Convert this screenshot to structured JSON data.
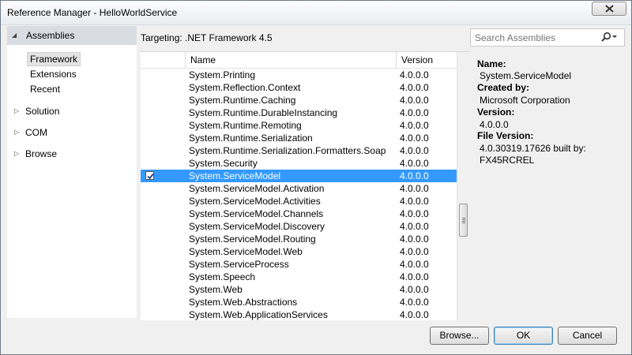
{
  "window": {
    "title": "Reference Manager - HelloWorldService",
    "close_glyph": "×"
  },
  "nav": {
    "expanded_group": "Assemblies",
    "sub_items": [
      "Framework",
      "Extensions",
      "Recent"
    ],
    "selected_sub_item": "Framework",
    "groups": [
      "Solution",
      "COM",
      "Browse"
    ]
  },
  "targeting": "Targeting: .NET Framework 4.5",
  "search": {
    "placeholder": "Search Assemblies",
    "icon": "search-icon"
  },
  "list": {
    "columns": {
      "name": "Name",
      "version": "Version"
    },
    "rows": [
      {
        "name": "System.Printing",
        "version": "4.0.0.0"
      },
      {
        "name": "System.Reflection.Context",
        "version": "4.0.0.0"
      },
      {
        "name": "System.Runtime.Caching",
        "version": "4.0.0.0"
      },
      {
        "name": "System.Runtime.DurableInstancing",
        "version": "4.0.0.0"
      },
      {
        "name": "System.Runtime.Remoting",
        "version": "4.0.0.0"
      },
      {
        "name": "System.Runtime.Serialization",
        "version": "4.0.0.0"
      },
      {
        "name": "System.Runtime.Serialization.Formatters.Soap",
        "version": "4.0.0.0"
      },
      {
        "name": "System.Security",
        "version": "4.0.0.0"
      },
      {
        "name": "System.ServiceModel",
        "version": "4.0.0.0",
        "selected": true,
        "checked": true
      },
      {
        "name": "System.ServiceModel.Activation",
        "version": "4.0.0.0"
      },
      {
        "name": "System.ServiceModel.Activities",
        "version": "4.0.0.0"
      },
      {
        "name": "System.ServiceModel.Channels",
        "version": "4.0.0.0"
      },
      {
        "name": "System.ServiceModel.Discovery",
        "version": "4.0.0.0"
      },
      {
        "name": "System.ServiceModel.Routing",
        "version": "4.0.0.0"
      },
      {
        "name": "System.ServiceModel.Web",
        "version": "4.0.0.0"
      },
      {
        "name": "System.ServiceProcess",
        "version": "4.0.0.0"
      },
      {
        "name": "System.Speech",
        "version": "4.0.0.0"
      },
      {
        "name": "System.Web",
        "version": "4.0.0.0"
      },
      {
        "name": "System.Web.Abstractions",
        "version": "4.0.0.0"
      },
      {
        "name": "System.Web.ApplicationServices",
        "version": "4.0.0.0"
      }
    ]
  },
  "details": {
    "name_label": "Name:",
    "name_value": "System.ServiceModel",
    "created_label": "Created by:",
    "created_value": "Microsoft Corporation",
    "version_label": "Version:",
    "version_value": "4.0.0.0",
    "file_version_label": "File Version:",
    "file_version_value_1": "4.0.30319.17626 built by:",
    "file_version_value_2": "FX45RCREL"
  },
  "buttons": {
    "browse": "Browse...",
    "ok": "OK",
    "cancel": "Cancel"
  },
  "colors": {
    "selection": "#3399ff",
    "nav_header": "#d9dde3",
    "dialog_bg": "#f0f0f0"
  }
}
